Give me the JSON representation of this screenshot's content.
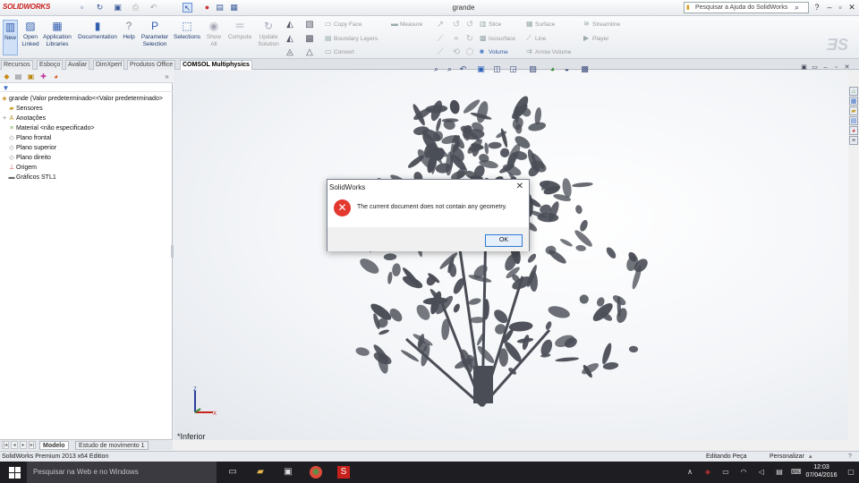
{
  "app": {
    "logo": "SOLIDWORKS",
    "document_title": "grande",
    "help_search_placeholder": "Pesquisar a Ajuda do SolidWorks"
  },
  "ribbon": {
    "buttons": [
      {
        "label": "New",
        "icon": "new-icon"
      },
      {
        "label": "Open Linked",
        "icon": "open-linked-icon"
      },
      {
        "label": "Application Libraries",
        "icon": "application-libraries-icon"
      },
      {
        "label": "Documentation",
        "icon": "documentation-icon"
      },
      {
        "label": "Help",
        "icon": "help-icon"
      },
      {
        "label": "Parameter Selection",
        "icon": "parameter-selection-icon"
      },
      {
        "label": "Selections",
        "icon": "selections-icon"
      },
      {
        "label": "Show All",
        "icon": "show-all-icon"
      },
      {
        "label": "Compute",
        "icon": "compute-icon"
      },
      {
        "label": "Update Solution",
        "icon": "update-solution-icon"
      }
    ],
    "geometry_tools": {
      "copy_face": "Copy Face",
      "boundary_layers": "Boundary Layers",
      "convert": "Convert",
      "measure": "Measure"
    },
    "results_tools": {
      "slice": "Slice",
      "isosurface": "Isosurface",
      "volume": "Volume",
      "surface": "Surface",
      "line": "Line",
      "arrow_volume": "Arrow Volume",
      "streamline": "Streamline",
      "player": "Player"
    }
  },
  "tabs": [
    "Recursos",
    "Esboço",
    "Avaliar",
    "DimXpert",
    "Produtos Office",
    "COMSOL Multiphysics"
  ],
  "feature_tree": {
    "root": "grande  (Valor predeterminado<<Valor predeterminado>",
    "items": [
      {
        "label": "Sensores",
        "icon": "sensor-folder-icon"
      },
      {
        "label": "Anotações",
        "icon": "annotations-icon"
      },
      {
        "label": "Material <não especificado>",
        "icon": "material-icon"
      },
      {
        "label": "Plano frontal",
        "icon": "plane-icon"
      },
      {
        "label": "Plano superior",
        "icon": "plane-icon"
      },
      {
        "label": "Plano direito",
        "icon": "plane-icon"
      },
      {
        "label": "Origem",
        "icon": "origin-icon"
      },
      {
        "label": "Gráficos STL1",
        "icon": "stl-graphics-icon"
      }
    ]
  },
  "bottom_tabs": [
    "Modelo",
    "Estudo de movimento 1"
  ],
  "viewport": {
    "view_label": "*Inferior",
    "model_color": "#4a4d56",
    "axis": {
      "z": "Z",
      "x": "X"
    }
  },
  "dialog": {
    "title": "SolidWorks",
    "message": "The current document does not contain any geometry.",
    "ok_label": "OK",
    "icon": "error-icon",
    "error_color": "#e2382f"
  },
  "statusbar": {
    "edition": "SolidWorks Premium 2013 x64 Edition",
    "mode": "Editando Peça",
    "customize": "Personalizar"
  },
  "taskbar": {
    "search_placeholder": "Pesquisar na Web e no Windows",
    "time": "12:03",
    "date": "07/04/2016"
  }
}
